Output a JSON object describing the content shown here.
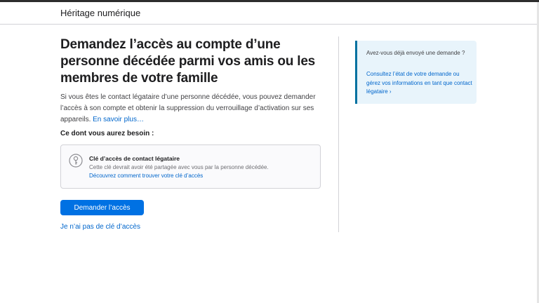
{
  "header": {
    "title": "Héritage numérique"
  },
  "main": {
    "title": "Demandez l’accès au compte d’une personne décédée parmi vos amis ou les membres de votre famille",
    "intro": "Si vous êtes le contact légataire d’une personne décédée, vous pouvez demander l’accès à son compte et obtenir la suppression du verrouillage d’activation sur ses appareils.",
    "learn_more_link": "En savoir plus…",
    "needs_label": "Ce dont vous aurez besoin :",
    "key_card": {
      "icon": "key-icon",
      "title": "Clé d’accès de contact légataire",
      "description": "Cette clé devrait avoir été partagée avec vous par la personne décédée.",
      "link": "Découvrez comment trouver votre clé d’accès"
    },
    "request_button": "Demander l’accès",
    "no_key_link": "Je n’ai pas de clé d’accès"
  },
  "aside": {
    "question": "Avez-vous déjà envoyé une demande ?",
    "link": "Consultez l’état de votre demande ou gérez vos informations en tant que contact légataire ›"
  },
  "colors": {
    "accent": "#0071e3",
    "link": "#0066cc",
    "aside_background": "#e8f4fb",
    "aside_border": "#0071a0"
  }
}
